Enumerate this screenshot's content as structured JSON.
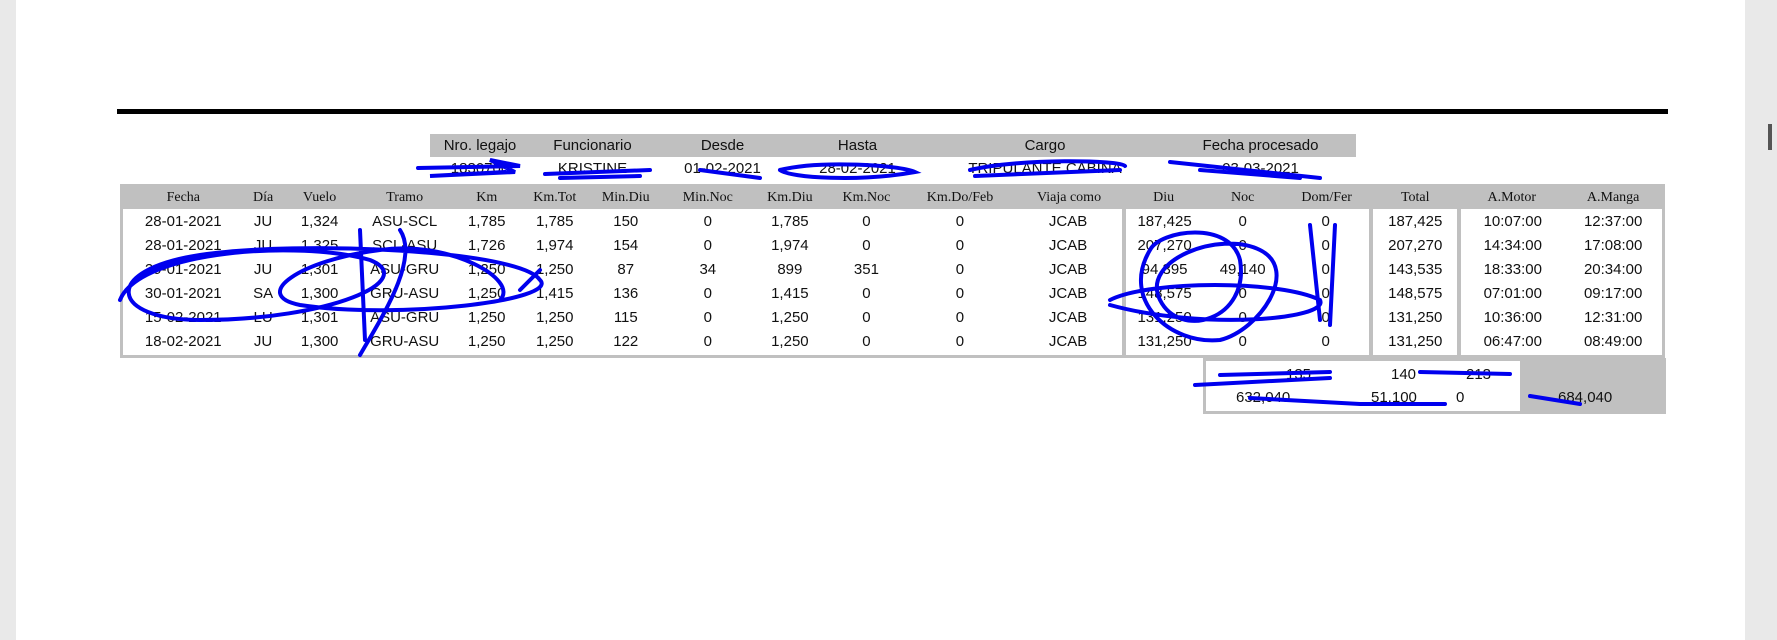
{
  "header": {
    "labels": [
      "Nro. legajo",
      "Funcionario",
      "Desde",
      "Hasta",
      "Cargo",
      "Fecha procesado"
    ],
    "values": [
      "1830700",
      "KRISTINE",
      "01-02-2021",
      "28-02-2021",
      "TRIPULANTE CABINA",
      "03-03-2021"
    ]
  },
  "table": {
    "columns": [
      "Fecha",
      "Día",
      "Vuelo",
      "Tramo",
      "Km",
      "Km.Tot",
      "Min.Diu",
      "Min.Noc",
      "Km.Diu",
      "Km.Noc",
      "Km.Do/Feb",
      "Viaja como",
      "Diu",
      "Noc",
      "Dom/Fer",
      "Total",
      "A.Motor",
      "A.Manga"
    ],
    "rows": [
      [
        "28-01-2021",
        "JU",
        "1,324",
        "ASU-SCL",
        "1,785",
        "1,785",
        "150",
        "0",
        "1,785",
        "0",
        "0",
        "JCAB",
        "187,425",
        "0",
        "0",
        "187,425",
        "10:07:00",
        "12:37:00"
      ],
      [
        "28-01-2021",
        "JU",
        "1,325",
        "SCL-ASU",
        "1,726",
        "1,974",
        "154",
        "0",
        "1,974",
        "0",
        "0",
        "JCAB",
        "207,270",
        "0",
        "0",
        "207,270",
        "14:34:00",
        "17:08:00"
      ],
      [
        "29-01-2021",
        "JU",
        "1,301",
        "ASU-GRU",
        "1,250",
        "1,250",
        "87",
        "34",
        "899",
        "351",
        "0",
        "JCAB",
        "94,395",
        "49,140",
        "0",
        "143,535",
        "18:33:00",
        "20:34:00"
      ],
      [
        "30-01-2021",
        "SA",
        "1,300",
        "GRU-ASU",
        "1,250",
        "1,415",
        "136",
        "0",
        "1,415",
        "0",
        "0",
        "JCAB",
        "148,575",
        "0",
        "0",
        "148,575",
        "07:01:00",
        "09:17:00"
      ],
      [
        "15-02-2021",
        "LU",
        "1,301",
        "ASU-GRU",
        "1,250",
        "1,250",
        "115",
        "0",
        "1,250",
        "0",
        "0",
        "JCAB",
        "131,250",
        "0",
        "0",
        "131,250",
        "10:36:00",
        "12:31:00"
      ],
      [
        "18-02-2021",
        "JU",
        "1,300",
        "GRU-ASU",
        "1,250",
        "1,250",
        "122",
        "0",
        "1,250",
        "0",
        "0",
        "JCAB",
        "131,250",
        "0",
        "0",
        "131,250",
        "06:47:00",
        "08:49:00"
      ]
    ]
  },
  "summary": {
    "row1": [
      "135",
      "140",
      "213"
    ],
    "row2": [
      "632,040",
      "51,100",
      "0"
    ],
    "total": "684,040"
  },
  "colors": {
    "header_gray": "#c0c0c0",
    "scribble": "#0000ee"
  }
}
